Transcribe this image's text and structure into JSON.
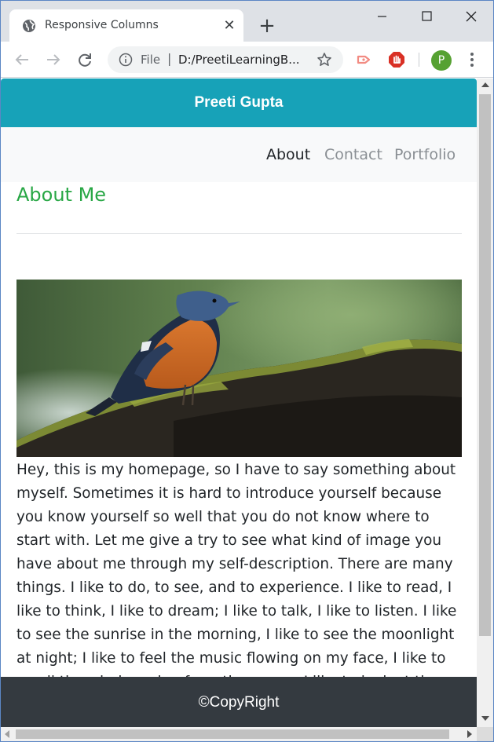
{
  "browser": {
    "tab_title": "Responsive Columns",
    "tab_close_glyph": "✕",
    "new_tab_glyph": "+",
    "omnibox_scheme": "File",
    "omnibox_separator": "|",
    "omnibox_url": "D:/PreetiLearningB...",
    "profile_initial": "P",
    "icons": [
      "globe-icon",
      "back-arrow-icon",
      "forward-arrow-icon",
      "reload-icon",
      "info-icon",
      "star-icon",
      "extension-icon",
      "adblock-icon",
      "kebab-menu-icon",
      "minimize-icon",
      "maximize-icon",
      "close-icon"
    ]
  },
  "page": {
    "header_title": "Preeti Gupta",
    "nav": {
      "about": "About",
      "contact": "Contact",
      "portfolio": "Portfolio"
    },
    "heading": "About Me",
    "image_subject": "bird-on-mossy-log",
    "body_text": "Hey, this is my homepage, so I have to say something about myself. Sometimes it is hard to introduce yourself because you know yourself so well that you do not know where to start with. Let me give a try to see what kind of image you have about me through my self-description. There are many things. I like to do, to see, and to experience. I like to read, I like to think, I like to dream; I like to talk, I like to listen. I like to see the sunrise in the morning, I like to see the moonlight at night; I like to feel the music flowing on my face, I like to smell the wind coming from the ocean. I like to look at the clouds in the sky with a blank mind, I like",
    "footer_text": "©CopyRight"
  },
  "colors": {
    "header_bg": "#17a2b8",
    "nav_bg": "#f8f9fa",
    "heading": "#28a745",
    "footer_bg": "#343a40",
    "nav_active": "#212529",
    "nav_inactive": "#8a8f94"
  }
}
